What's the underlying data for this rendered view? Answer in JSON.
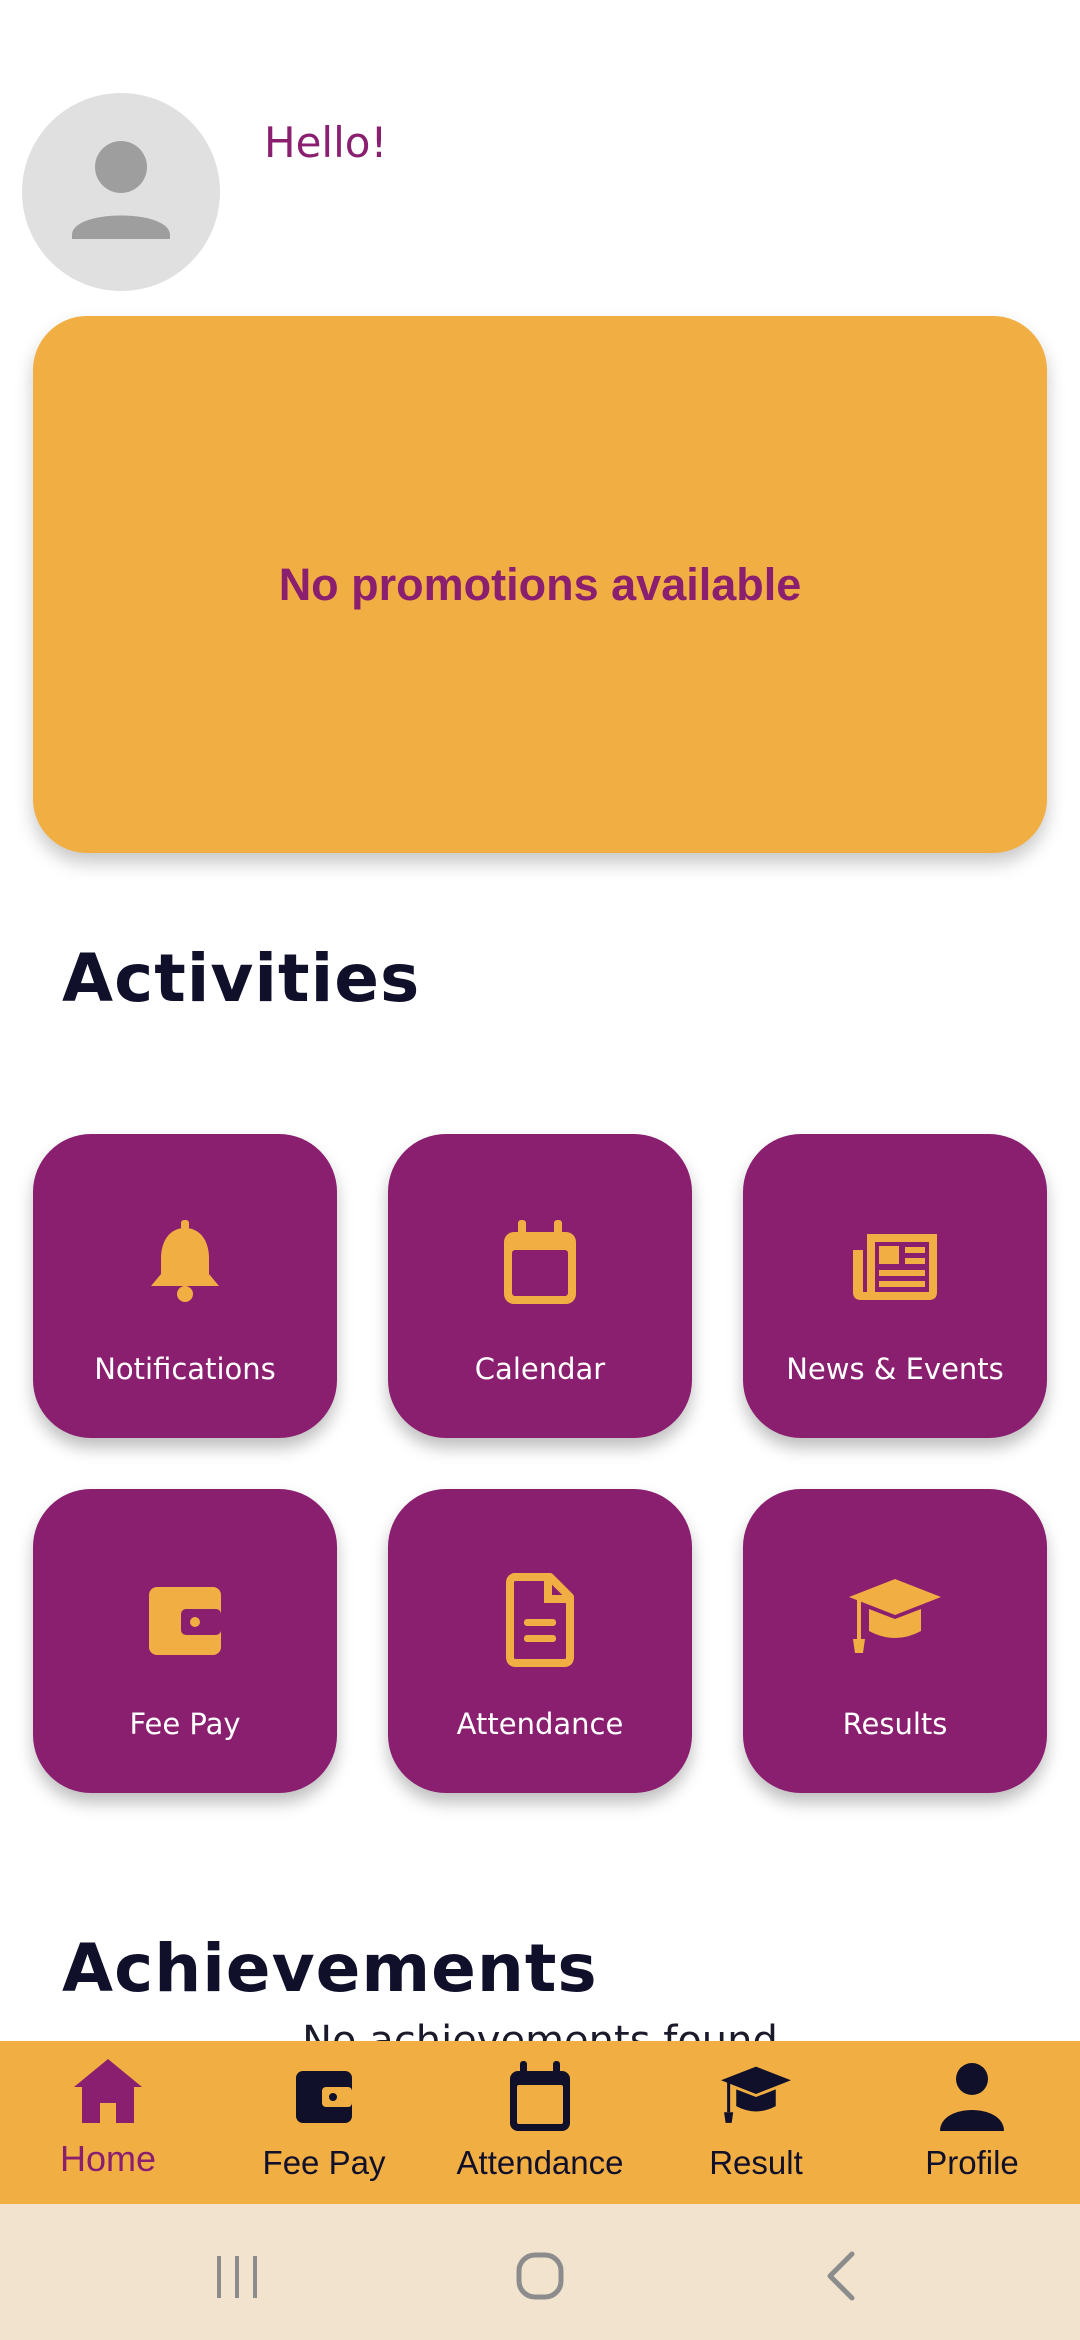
{
  "header": {
    "greeting": "Hello!",
    "avatar_icon": "person-icon"
  },
  "promo": {
    "message": "No promotions available"
  },
  "activities": {
    "title": "Activities",
    "items": [
      {
        "label": "Notifications",
        "icon": "bell-icon"
      },
      {
        "label": "Calendar",
        "icon": "calendar-icon"
      },
      {
        "label": "News & Events",
        "icon": "newspaper-icon"
      },
      {
        "label": "Fee Pay",
        "icon": "wallet-icon"
      },
      {
        "label": "Attendance",
        "icon": "document-icon"
      },
      {
        "label": "Results",
        "icon": "graduation-cap-icon"
      }
    ]
  },
  "achievements": {
    "title": "Achievements",
    "empty_text": "No achievements found"
  },
  "bottom_nav": {
    "items": [
      {
        "label": "Home",
        "icon": "home-icon",
        "active": true
      },
      {
        "label": "Fee Pay",
        "icon": "wallet-icon",
        "active": false
      },
      {
        "label": "Attendance",
        "icon": "calendar-icon",
        "active": false
      },
      {
        "label": "Result",
        "icon": "graduation-cap-icon",
        "active": false
      },
      {
        "label": "Profile",
        "icon": "person-icon",
        "active": false
      }
    ]
  },
  "system_nav": {
    "buttons": [
      "recent-apps-icon",
      "home-circle-icon",
      "back-icon"
    ]
  },
  "colors": {
    "primary": "#8a1f6f",
    "accent": "#f1ae43",
    "text_dark": "#10102a"
  }
}
